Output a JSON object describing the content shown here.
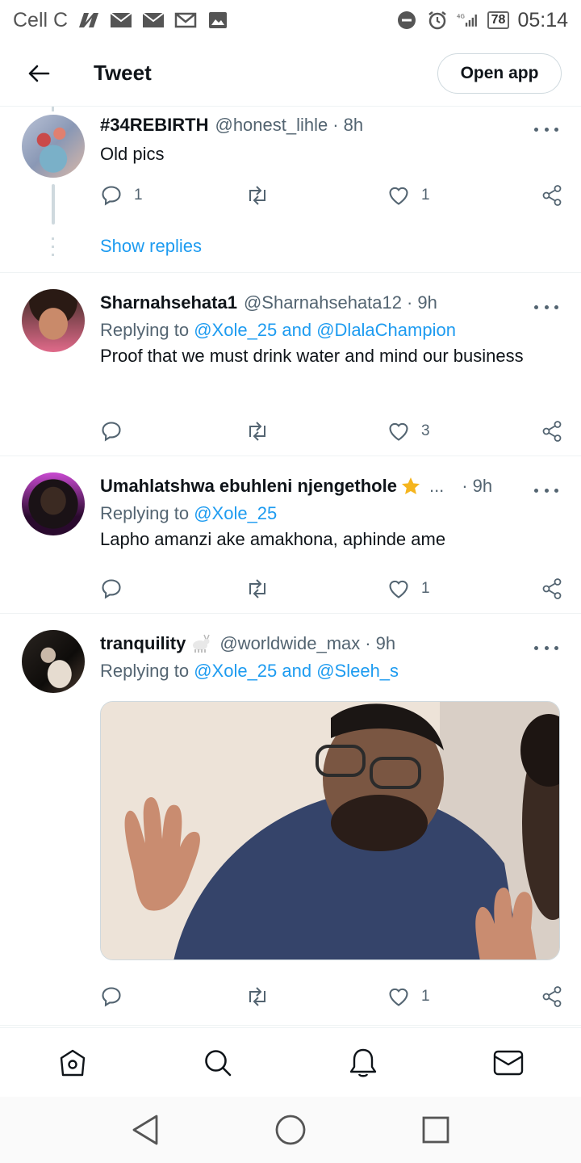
{
  "status_bar": {
    "carrier": "Cell C",
    "battery": "78",
    "time": "05:14",
    "network": "4G"
  },
  "header": {
    "title": "Tweet",
    "open_app_label": "Open app"
  },
  "tweets": [
    {
      "name": "#34REBIRTH",
      "handle": "@honest_lihle",
      "time": "8h",
      "text": "Old pics",
      "replies": "1",
      "likes": "1",
      "show_replies": "Show replies"
    },
    {
      "name": "Sharnahsehata1",
      "handle": "@Sharnahsehata12",
      "time": "9h",
      "replying_prefix": "Replying to",
      "replying_to": "@Xole_25 and @DlalaChampion",
      "text": "Proof that we must drink water and mind our business",
      "likes": "3"
    },
    {
      "name": "Umahlatshwa ebuhleni njengethole",
      "handle": "...",
      "time": "9h",
      "replying_prefix": "Replying to",
      "replying_to": "@Xole_25",
      "text": "Lapho amanzi ake amakhona, aphinde ame",
      "likes": "1"
    },
    {
      "name": "tranquility",
      "handle": "@worldwide_max",
      "time": "9h",
      "replying_prefix": "Replying to",
      "replying_to": "@Xole_25 and @Sleeh_s",
      "likes": "1"
    }
  ],
  "separator": "·",
  "icons": {
    "back": "arrow-left-icon",
    "reply": "speech-bubble-icon",
    "retweet": "retweet-icon",
    "like": "heart-icon",
    "share": "share-icon",
    "more": "more-horizontal-icon",
    "home": "home-icon",
    "search": "search-icon",
    "notifications": "bell-icon",
    "messages": "envelope-icon"
  },
  "colors": {
    "accent": "#1d9bf0",
    "text": "#0f1419",
    "secondary": "#536471",
    "star": "#f5b51e"
  }
}
